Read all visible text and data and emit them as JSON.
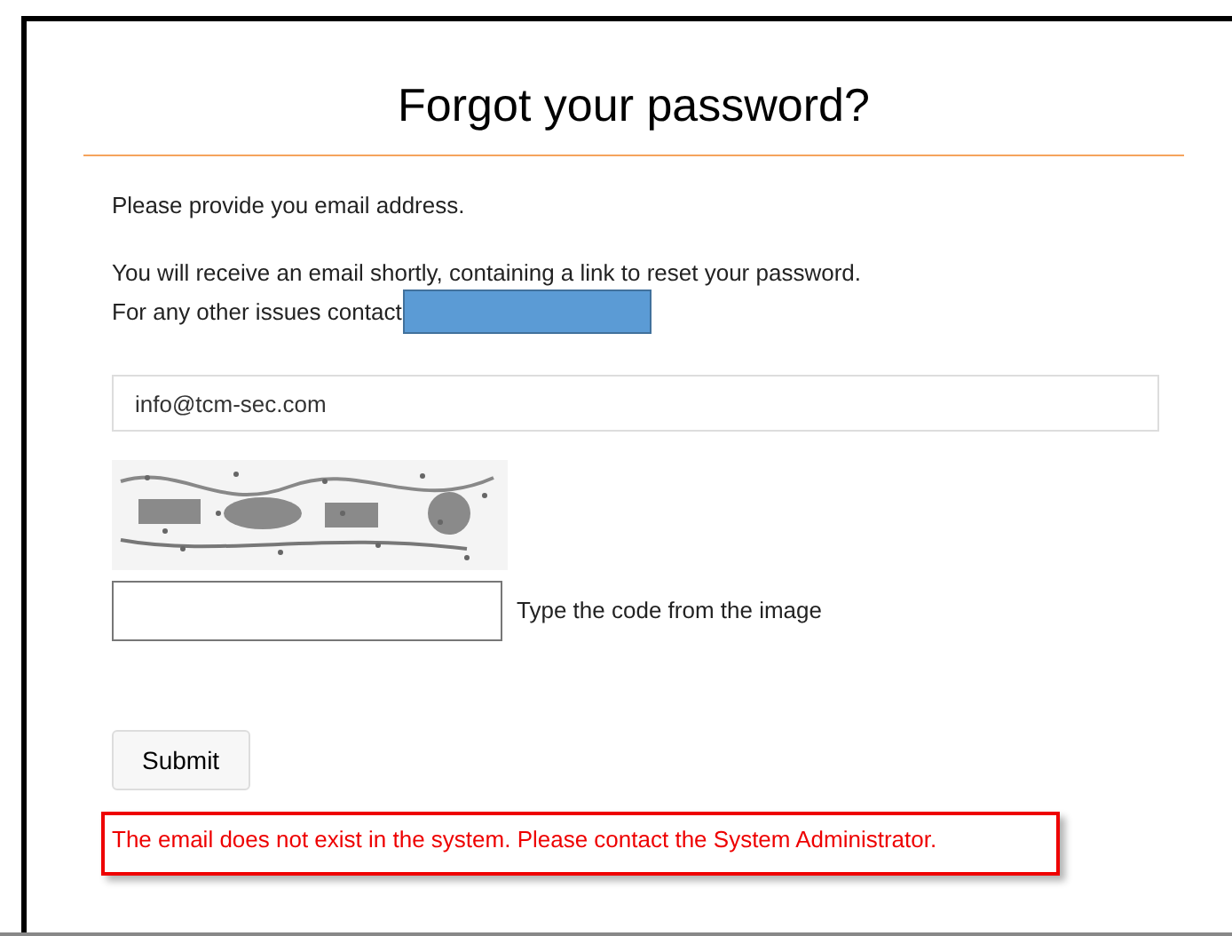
{
  "title": "Forgot your password?",
  "intro": "Please provide you email address.",
  "info_lines": [
    "You will receive an email shortly, containing a link to reset your password.",
    "For any other issues contact"
  ],
  "email_field": {
    "value": "info@tcm-sec.com"
  },
  "captcha": {
    "hint": "Type the code from the image"
  },
  "submit_button": "Submit",
  "error_message": "The email does not exist in the system. Please contact the System Administrator."
}
